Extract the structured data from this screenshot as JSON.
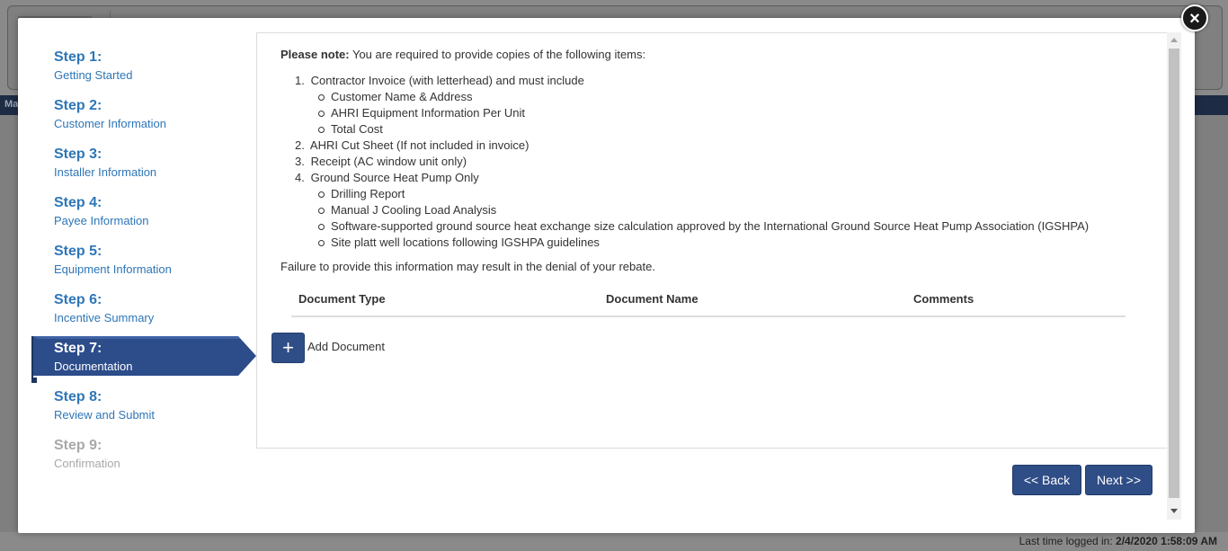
{
  "background": {
    "nav_text": "Ma",
    "last_login_label": "Last time logged in:",
    "last_login_value": "2/4/2020 1:58:09 AM"
  },
  "modal": {
    "close_icon": "close-icon"
  },
  "steps": [
    {
      "num": "Step 1:",
      "label": "Getting Started",
      "state": "link"
    },
    {
      "num": "Step 2:",
      "label": "Customer Information",
      "state": "link"
    },
    {
      "num": "Step 3:",
      "label": "Installer Information",
      "state": "link"
    },
    {
      "num": "Step 4:",
      "label": "Payee Information",
      "state": "link"
    },
    {
      "num": "Step 5:",
      "label": "Equipment Information",
      "state": "link"
    },
    {
      "num": "Step 6:",
      "label": "Incentive Summary",
      "state": "link"
    },
    {
      "num": "Step 7:",
      "label": "Documentation",
      "state": "active"
    },
    {
      "num": "Step 8:",
      "label": "Review and Submit",
      "state": "link"
    },
    {
      "num": "Step 9:",
      "label": "Confirmation",
      "state": "disabled"
    }
  ],
  "content": {
    "note_bold": "Please note:",
    "note_text": " You are required to provide copies of the following items:",
    "items": [
      {
        "n": "1.",
        "text": "Contractor Invoice (with letterhead) and must include",
        "subs": [
          "Customer Name & Address",
          "AHRI Equipment Information Per Unit",
          "Total Cost"
        ]
      },
      {
        "n": "2.",
        "text": "AHRI Cut Sheet (If not included in invoice)",
        "subs": []
      },
      {
        "n": "3.",
        "text": "Receipt (AC window unit only)",
        "subs": []
      },
      {
        "n": "4.",
        "text": "Ground Source Heat Pump Only",
        "subs": [
          "Drilling Report",
          "Manual J Cooling Load Analysis",
          "Software-supported ground source heat exchange size calculation approved by the International Ground Source Heat Pump Association (IGSHPA)",
          "Site platt well locations following IGSHPA guidelines"
        ]
      }
    ],
    "warning": "Failure to provide this information may result in the denial of your rebate.",
    "table_headers": [
      "Document Type",
      "Document Name",
      "Comments"
    ],
    "add_button_symbol": "+",
    "add_label": "Add Document"
  },
  "buttons": {
    "back": "<< Back",
    "next": "Next >>"
  },
  "colors": {
    "accent": "#2f4d86",
    "step_link": "#2e76b7",
    "step_disabled": "#a8a8a8"
  }
}
